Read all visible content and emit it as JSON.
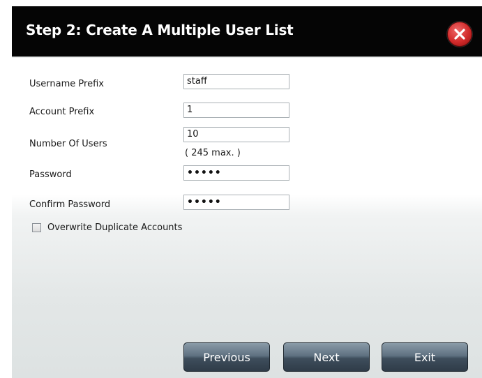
{
  "dialog": {
    "title": "Step 2: Create A Multiple User List",
    "close_icon": "close-icon"
  },
  "form": {
    "username_prefix": {
      "label": "Username Prefix",
      "value": "staff"
    },
    "account_prefix": {
      "label": "Account Prefix",
      "value": "1"
    },
    "number_of_users": {
      "label": "Number Of Users",
      "value": "10",
      "hint": "( 245 max. )"
    },
    "password": {
      "label": "Password",
      "value": "•••••"
    },
    "confirm_password": {
      "label": "Confirm Password",
      "value": "•••••"
    },
    "overwrite": {
      "label": "Overwrite Duplicate Accounts",
      "checked": false
    }
  },
  "buttons": {
    "previous": "Previous",
    "next": "Next",
    "exit": "Exit"
  },
  "colors": {
    "title_bar": "#050505",
    "close_red": "#d12a2a",
    "button_dark": "#3e4e5c"
  }
}
